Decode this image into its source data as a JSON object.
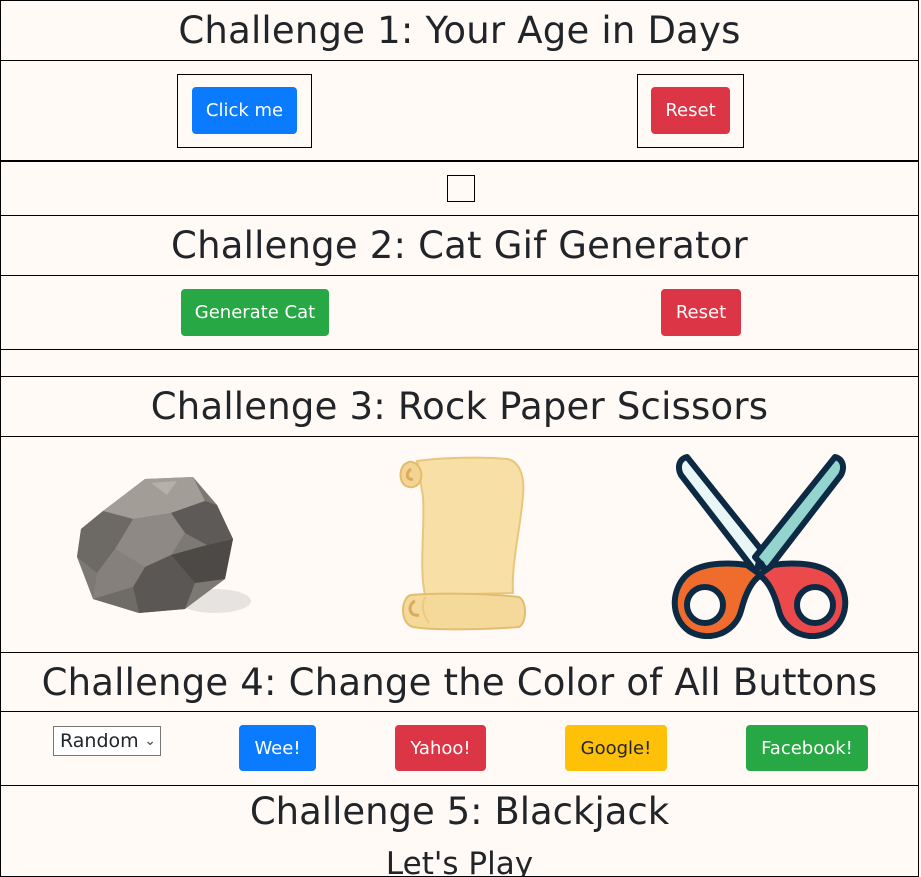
{
  "challenge1": {
    "title": "Challenge 1: Your Age in Days",
    "click_label": "Click me",
    "reset_label": "Reset"
  },
  "challenge2": {
    "title": "Challenge 2: Cat Gif Generator",
    "generate_label": "Generate Cat",
    "reset_label": "Reset"
  },
  "challenge3": {
    "title": "Challenge 3: Rock Paper Scissors",
    "choices": [
      "rock",
      "paper",
      "scissors"
    ]
  },
  "challenge4": {
    "title": "Challenge 4: Change the Color of All Buttons",
    "select_value": "Random",
    "buttons": [
      "Wee!",
      "Yahoo!",
      "Google!",
      "Facebook!"
    ]
  },
  "challenge5": {
    "title": "Challenge 5: Blackjack",
    "subtitle": "Let's Play"
  },
  "colors": {
    "background": "#fffaf6",
    "blue": "#0a7bff",
    "red": "#dc3545",
    "green": "#28a745",
    "yellow": "#ffc107"
  }
}
